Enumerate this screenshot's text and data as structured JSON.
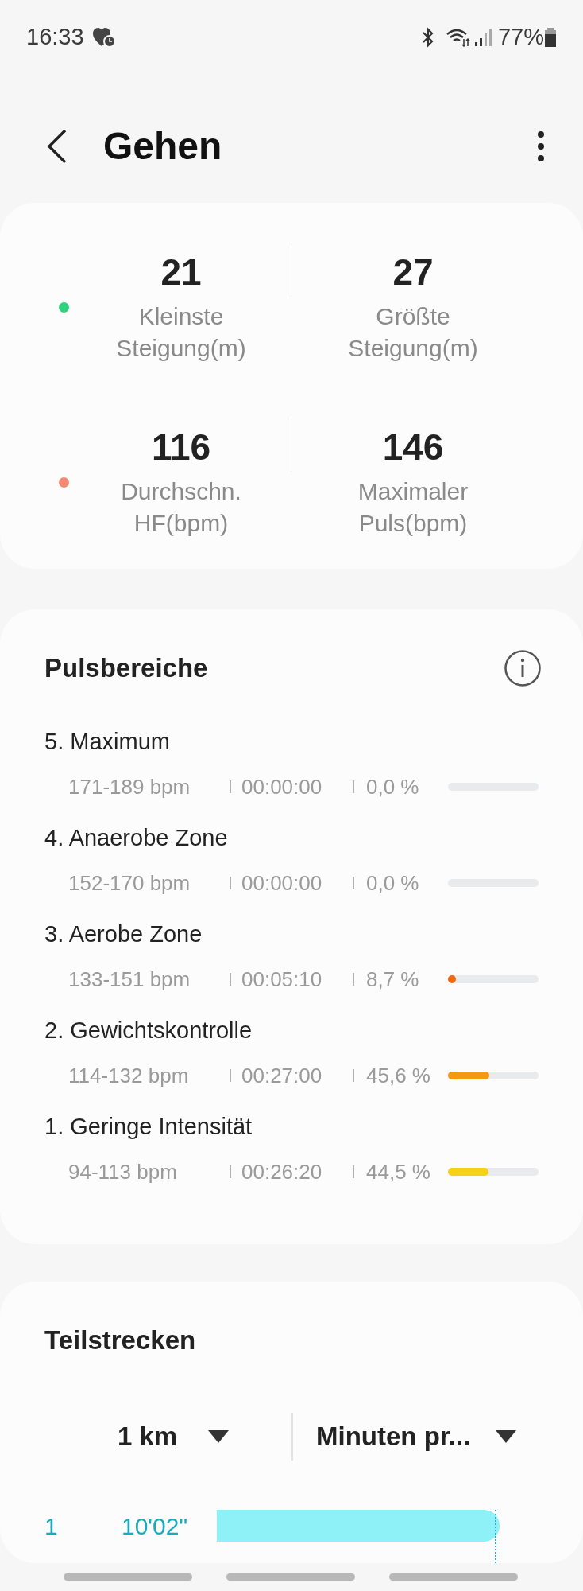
{
  "status_bar": {
    "time": "16:33",
    "battery": "77%"
  },
  "header": {
    "title": "Gehen"
  },
  "summary": {
    "rows": [
      {
        "color": "#2fd37f",
        "stats": [
          {
            "value": "21",
            "label": "Kleinste Steigung(m)"
          },
          {
            "value": "27",
            "label": "Größte Steigung(m)"
          }
        ]
      },
      {
        "color": "#f38a72",
        "stats": [
          {
            "value": "116",
            "label": "Durchschn. HF(bpm)"
          },
          {
            "value": "146",
            "label": "Maximaler Puls(bpm)"
          }
        ]
      }
    ]
  },
  "heart_rate_zones": {
    "title": "Pulsbereiche",
    "zones": [
      {
        "name": "5. Maximum",
        "range": "171-189 bpm",
        "time": "00:00:00",
        "percent": "0,0 %"
      },
      {
        "name": "4. Anaerobe Zone",
        "range": "152-170 bpm",
        "time": "00:00:00",
        "percent": "0,0 %"
      },
      {
        "name": "3. Aerobe Zone",
        "range": "133-151 bpm",
        "time": "00:05:10",
        "percent": "8,7 %",
        "level": 0.087,
        "color": "#f06a14"
      },
      {
        "name": "2. Gewichtskontrolle",
        "range": "114-132 bpm",
        "time": "00:27:00",
        "percent": "45,6 %",
        "level": 0.456,
        "color": "#f39a12"
      },
      {
        "name": "1. Geringe Intensität",
        "range": "94-113 bpm",
        "time": "00:26:20",
        "percent": "44,5 %",
        "level": 0.445,
        "color": "#f5d214"
      }
    ]
  },
  "splits": {
    "title": "Teilstrecken",
    "distance_dropdown": "1 km",
    "metric_dropdown": "Minuten pr...",
    "rows": [
      {
        "index": "1",
        "pace": "10'02\""
      }
    ]
  }
}
